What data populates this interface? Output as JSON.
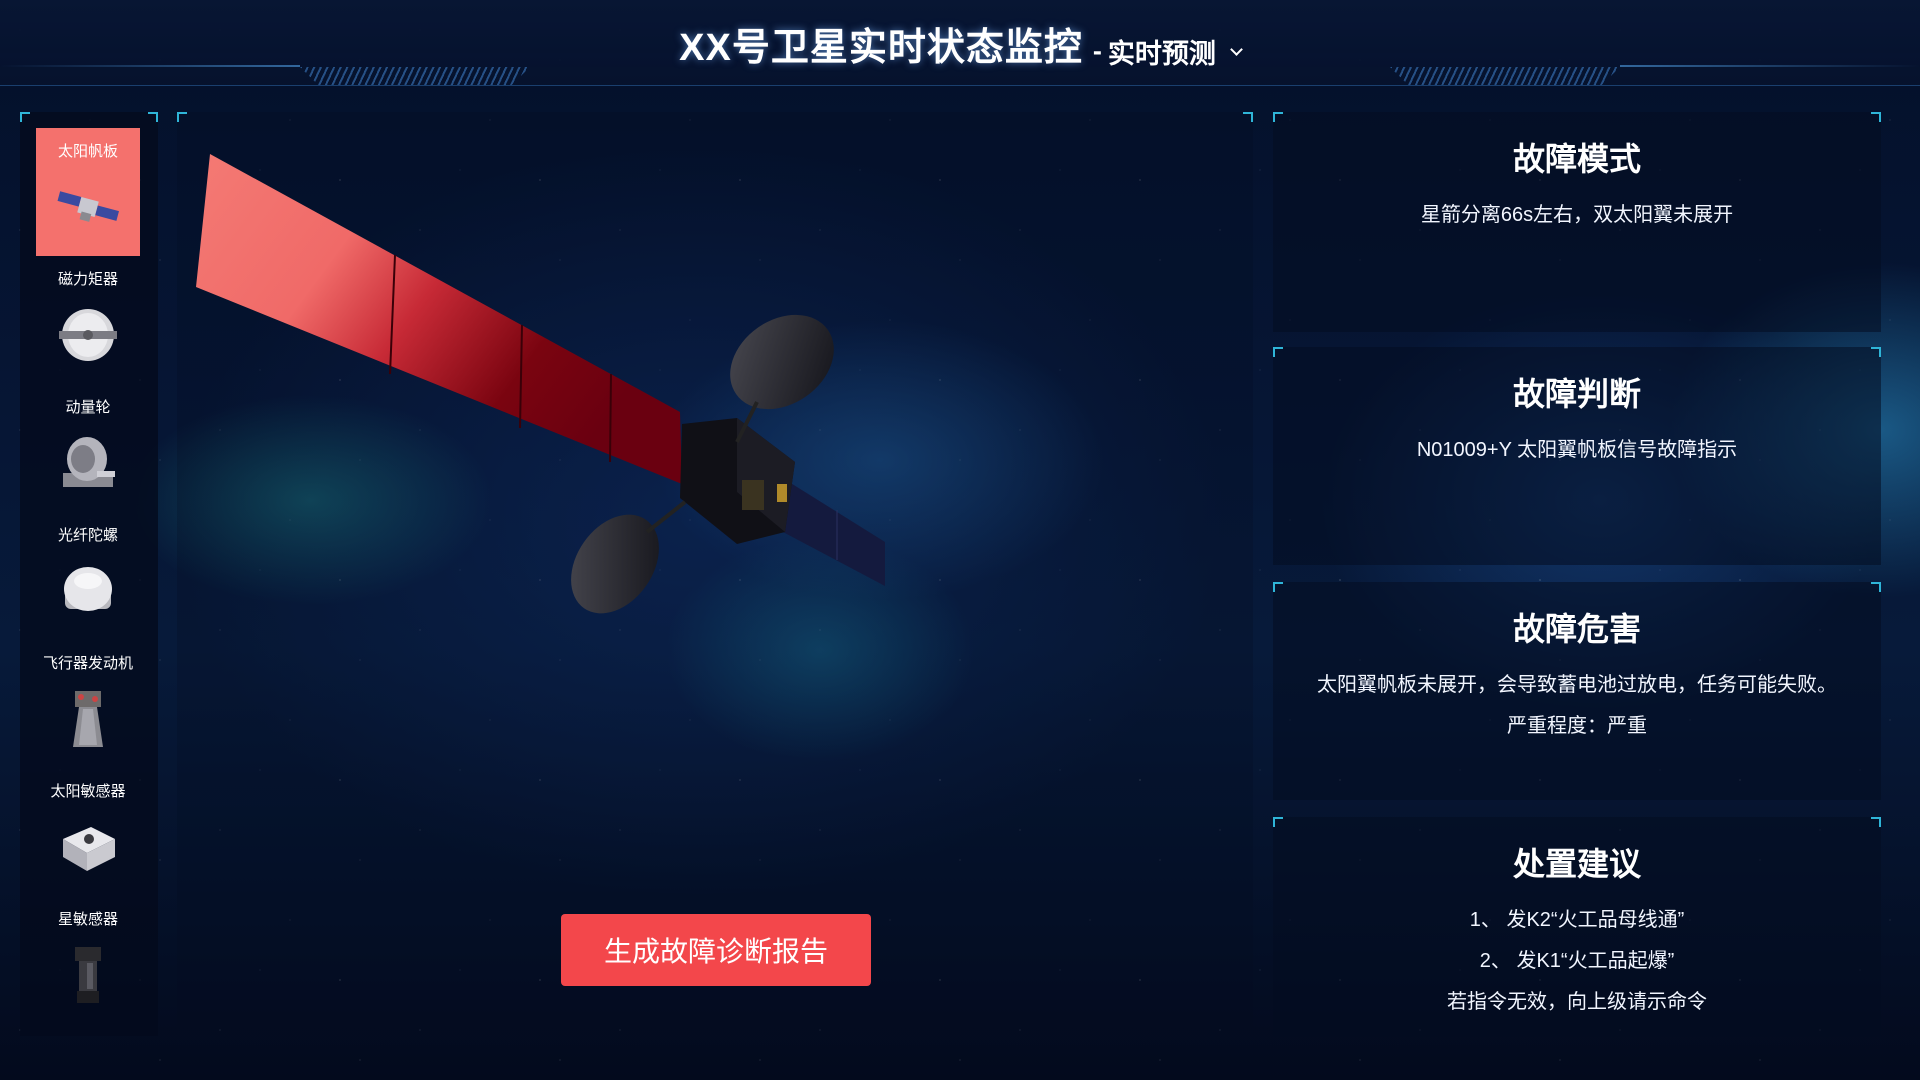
{
  "header": {
    "title": "XX号卫星实时状态监控",
    "separator": "-",
    "mode": "实时预测"
  },
  "components": [
    {
      "label": "太阳帆板",
      "icon": "solar-panel-icon",
      "active": true
    },
    {
      "label": "磁力矩器",
      "icon": "magnetorquer-icon",
      "active": false
    },
    {
      "label": "动量轮",
      "icon": "momentum-wheel-icon",
      "active": false
    },
    {
      "label": "光纤陀螺",
      "icon": "fiber-gyro-icon",
      "active": false
    },
    {
      "label": "飞行器发动机",
      "icon": "engine-icon",
      "active": false
    },
    {
      "label": "太阳敏感器",
      "icon": "sun-sensor-icon",
      "active": false
    },
    {
      "label": "星敏感器",
      "icon": "star-sensor-icon",
      "active": false
    }
  ],
  "center": {
    "report_button": "生成故障诊断报告"
  },
  "fault_mode": {
    "title": "故障模式",
    "lines": [
      "星箭分离66s左右，双太阳翼未展开"
    ]
  },
  "fault_judgement": {
    "title": "故障判断",
    "lines": [
      "N01009+Y 太阳翼帆板信号故障指示"
    ]
  },
  "fault_hazard": {
    "title": "故障危害",
    "lines": [
      "太阳翼帆板未展开，会导致蓄电池过放电，任务可能失败。",
      "严重程度：严重"
    ]
  },
  "disposal": {
    "title": "处置建议",
    "lines": [
      "1、 发K2“火工品母线通”",
      "2、 发K1“火工品起爆”",
      "若指令无效，向上级请示命令"
    ]
  },
  "colors": {
    "accent_active": "#f4716d",
    "button": "#f3474b",
    "corner": "#2fb5d8"
  }
}
